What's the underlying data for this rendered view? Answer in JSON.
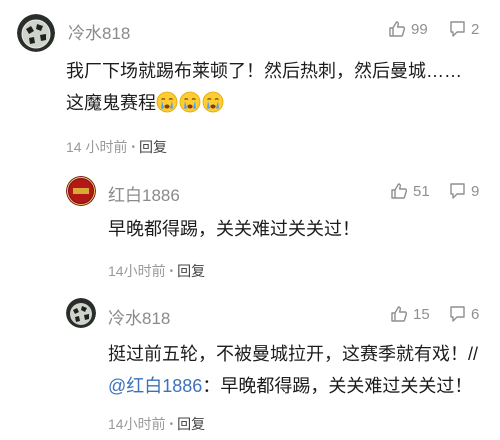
{
  "comments": [
    {
      "user": "冷水818",
      "likes": "99",
      "replies": "2",
      "text": "我厂下场就踢布莱顿了！然后热刺，然后曼城……",
      "text2": "这魔鬼赛程",
      "emoji_count": 3,
      "emoji_icon": "crying-face-icon",
      "time": "14 小时前",
      "reply_label": "回复"
    },
    {
      "user": "红白1886",
      "likes": "51",
      "replies": "9",
      "text": "早晚都得踢，关关难过关关过！",
      "time": "14小时前",
      "reply_label": "回复"
    },
    {
      "user": "冷水818",
      "likes": "15",
      "replies": "6",
      "text": "挺过前五轮，不被曼城拉开，这赛季就有戏！//",
      "mention": "@红白1886",
      "quote": "：早晚都得踢，关关难过关关过！",
      "time": "14小时前",
      "reply_label": "回复"
    }
  ],
  "colors": {
    "mention": "#3d72b8",
    "meta": "#9a9a9a",
    "name": "#8a8a8a"
  }
}
